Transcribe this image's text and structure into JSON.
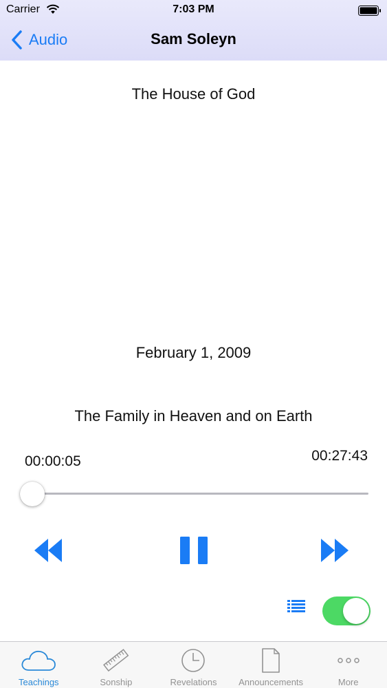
{
  "status_bar": {
    "carrier": "Carrier",
    "time": "7:03 PM",
    "icons": [
      "wifi-icon",
      "battery-icon"
    ]
  },
  "nav": {
    "back_label": "Audio",
    "title": "Sam Soleyn"
  },
  "player": {
    "series": "The House of God",
    "date": "February 1, 2009",
    "sermon_title": "The Family in Heaven and on Earth",
    "elapsed": "00:00:05",
    "total": "00:27:43",
    "progress_fraction": 0.003,
    "controls": [
      "rewind-icon",
      "pause-icon",
      "fast-forward-icon"
    ],
    "playlist_icon": "list-icon",
    "toggle_on": true
  },
  "colors": {
    "accent": "#1a7cf5",
    "toggle_on": "#4cd964",
    "tab_active": "#2a89d8",
    "tab_inactive": "#929292",
    "nav_background": "#dcdcf8"
  },
  "tabs": [
    {
      "label": "Teachings",
      "icon": "cloud-icon",
      "active": true
    },
    {
      "label": "Sonship",
      "icon": "ruler-icon",
      "active": false
    },
    {
      "label": "Revelations",
      "icon": "clock-icon",
      "active": false
    },
    {
      "label": "Announcements",
      "icon": "document-icon",
      "active": false
    },
    {
      "label": "More",
      "icon": "more-icon",
      "active": false
    }
  ]
}
